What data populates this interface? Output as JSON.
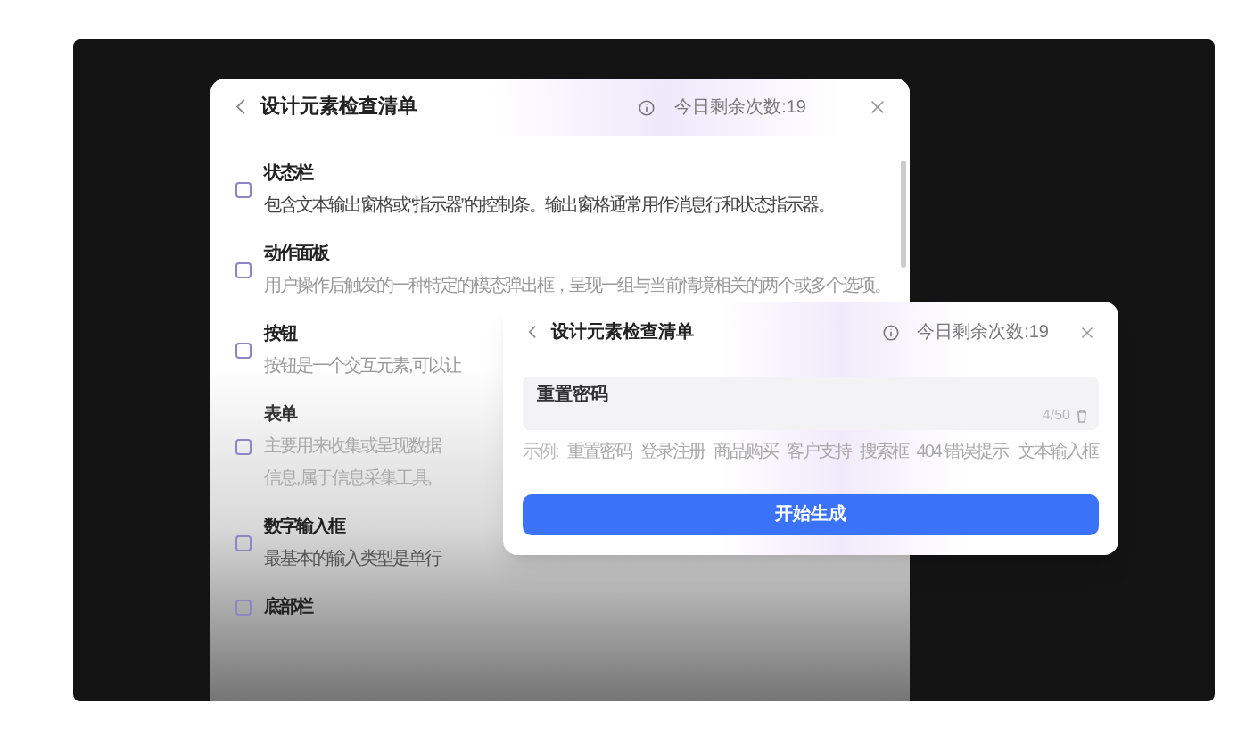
{
  "back_panel": {
    "title": "设计元素检查清单",
    "quota": "今日剩余次数:19",
    "items": [
      {
        "title": "状态栏",
        "description": "包含文本输出窗格或“指示器”的控制条。输出窗格通常用作消息行和状态指示器。",
        "checked": false
      },
      {
        "title": "动作面板",
        "description": "用户操作后触发的一种特定的模态弹出框，呈现一组与当前情境相关的两个或多个选项。",
        "checked": false
      },
      {
        "title": "按钮",
        "description": "按钮是一个交互元素,可以让",
        "checked": false
      },
      {
        "title": "表单",
        "description": "主要用来收集或呈现数据",
        "description_2": "信息,属于信息采集工具,",
        "checked": false
      },
      {
        "title": "数字输入框",
        "description": "最基本的输入类型是单行",
        "checked": false
      },
      {
        "title": "底部栏",
        "checked": false
      }
    ]
  },
  "dialog": {
    "title": "设计元素检查清单",
    "quota": "今日剩余次数:19",
    "input_value": "重置密码",
    "counter": "4/50",
    "examples_label": "示例:",
    "examples": [
      "重置密码",
      "登录注册",
      "商品购买",
      "客户支持",
      "搜索框",
      "404 错误提示",
      "文本输入框"
    ],
    "submit": "开始生成"
  }
}
